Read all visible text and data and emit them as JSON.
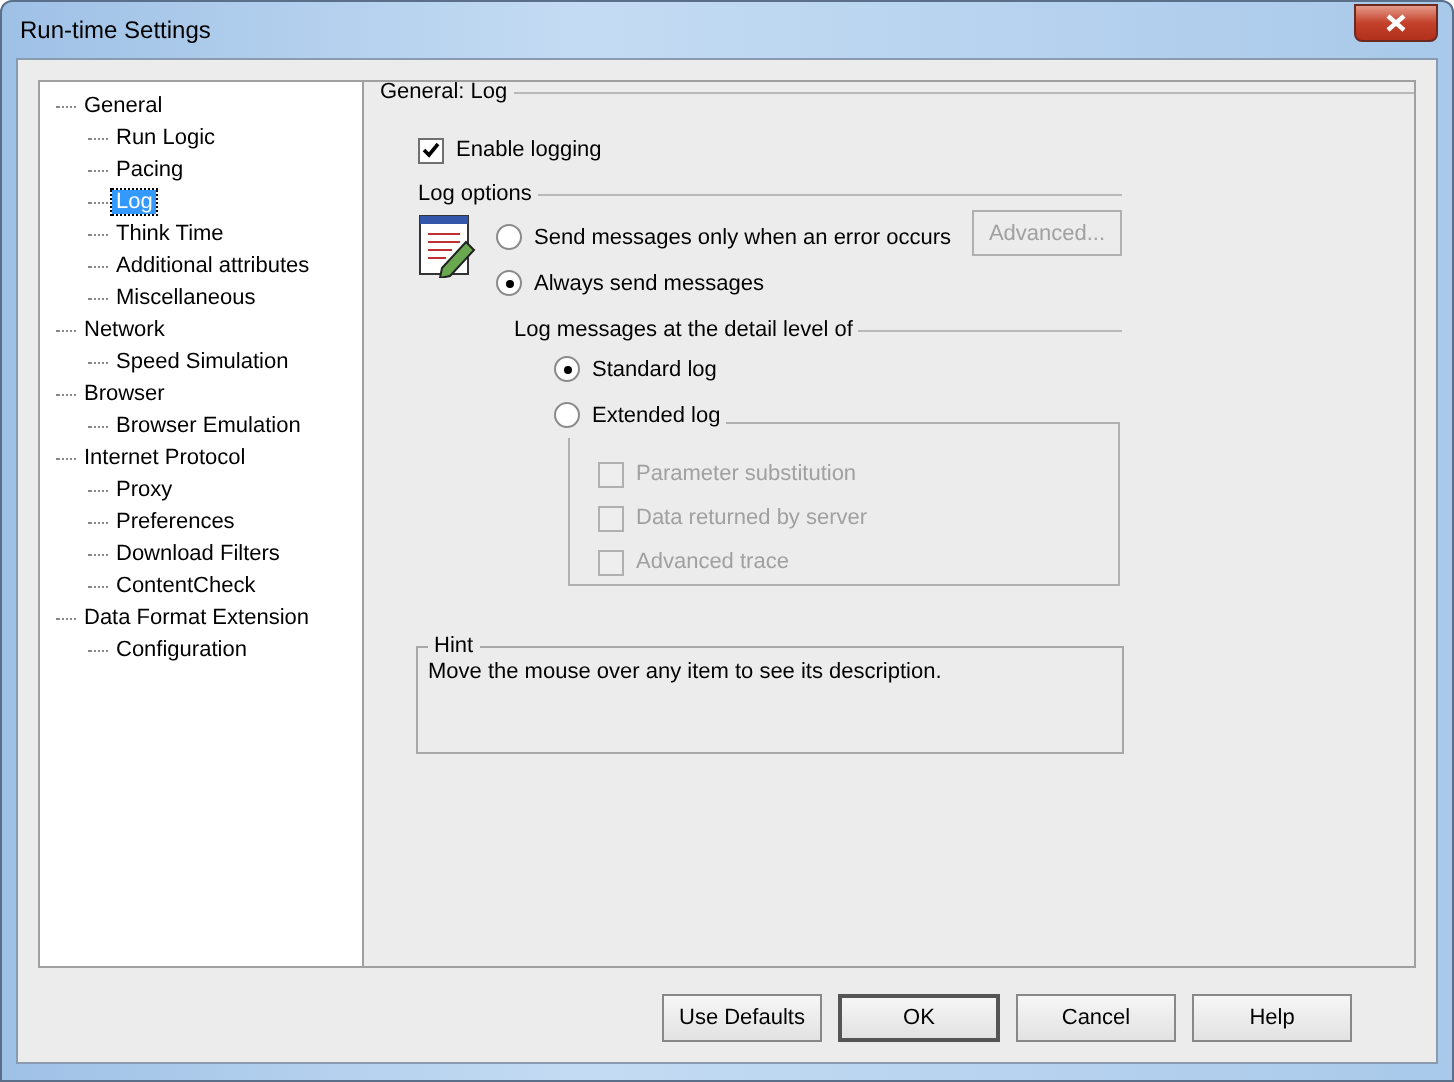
{
  "window": {
    "title": "Run-time Settings"
  },
  "tree": [
    {
      "label": "General",
      "selected": false,
      "children": [
        {
          "label": "Run Logic",
          "selected": false
        },
        {
          "label": "Pacing",
          "selected": false
        },
        {
          "label": "Log",
          "selected": true
        },
        {
          "label": "Think Time",
          "selected": false
        },
        {
          "label": "Additional attributes",
          "selected": false
        },
        {
          "label": "Miscellaneous",
          "selected": false
        }
      ]
    },
    {
      "label": "Network",
      "selected": false,
      "children": [
        {
          "label": "Speed Simulation",
          "selected": false
        }
      ]
    },
    {
      "label": "Browser",
      "selected": false,
      "children": [
        {
          "label": "Browser Emulation",
          "selected": false
        }
      ]
    },
    {
      "label": "Internet Protocol",
      "selected": false,
      "children": [
        {
          "label": "Proxy",
          "selected": false
        },
        {
          "label": "Preferences",
          "selected": false
        },
        {
          "label": "Download Filters",
          "selected": false
        },
        {
          "label": "ContentCheck",
          "selected": false
        }
      ]
    },
    {
      "label": "Data Format Extension",
      "selected": false,
      "children": [
        {
          "label": "Configuration",
          "selected": false
        }
      ]
    }
  ],
  "panel": {
    "title": "General: Log",
    "enable_logging": {
      "label": "Enable logging",
      "checked": true
    },
    "log_options": {
      "title": "Log options",
      "modes": [
        {
          "label": "Send messages only when an error occurs",
          "selected": false
        },
        {
          "label": "Always send messages",
          "selected": true
        }
      ],
      "advanced_button": {
        "label": "Advanced...",
        "disabled": true
      },
      "detail_title": "Log messages at the detail level of",
      "levels": [
        {
          "label": "Standard log",
          "selected": true
        },
        {
          "label": "Extended log",
          "selected": false
        }
      ],
      "extended_options": [
        {
          "label": "Parameter substitution",
          "checked": false,
          "disabled": true
        },
        {
          "label": "Data returned by server",
          "checked": false,
          "disabled": true
        },
        {
          "label": "Advanced trace",
          "checked": false,
          "disabled": true
        }
      ]
    },
    "hint": {
      "title": "Hint",
      "text": "Move the mouse over any item to see its description."
    }
  },
  "buttons": [
    {
      "label": "Use Defaults",
      "default": false
    },
    {
      "label": "OK",
      "default": true
    },
    {
      "label": "Cancel",
      "default": false
    },
    {
      "label": "Help",
      "default": false
    }
  ]
}
